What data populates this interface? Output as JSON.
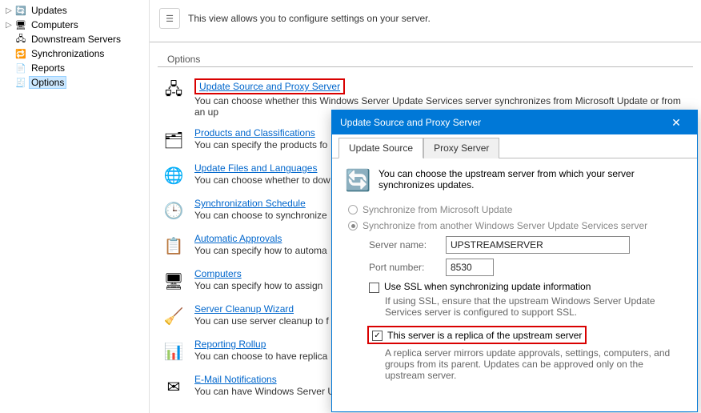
{
  "tree": {
    "items": [
      {
        "label": "Updates",
        "icon": "🔄",
        "expander": "▷"
      },
      {
        "label": "Computers",
        "icon": "🖥",
        "expander": "▷"
      },
      {
        "label": "Downstream Servers",
        "icon": "🖧",
        "expander": " "
      },
      {
        "label": "Synchronizations",
        "icon": "🔁",
        "expander": " "
      },
      {
        "label": "Reports",
        "icon": "📄",
        "expander": " "
      },
      {
        "label": "Options",
        "icon": "🧾",
        "expander": " ",
        "selected": true
      }
    ]
  },
  "page": {
    "desc": "This view allows you to configure settings on your server.",
    "options_header": "Options"
  },
  "options": [
    {
      "title": "Update Source and Proxy Server",
      "desc": "You can choose whether this Windows Server Update Services server synchronizes from Microsoft Update or from an up",
      "highlight": true,
      "icon": "🖧"
    },
    {
      "title": "Products and Classifications",
      "desc": "You can specify the products fo",
      "icon": "🗂"
    },
    {
      "title": "Update Files and Languages",
      "desc": "You can choose whether to dow",
      "icon": "🌐"
    },
    {
      "title": "Synchronization Schedule",
      "desc": "You can choose to synchronize",
      "icon": "🕒"
    },
    {
      "title": "Automatic Approvals",
      "desc": "You can specify how to automa",
      "icon": "📋"
    },
    {
      "title": "Computers",
      "desc": "You can specify how to assign",
      "icon": "🖥"
    },
    {
      "title": "Server Cleanup Wizard",
      "desc": "You can use server cleanup to f",
      "icon": "🧹"
    },
    {
      "title": "Reporting Rollup",
      "desc": "You can choose to have replica",
      "icon": "📊"
    },
    {
      "title": "E-Mail Notifications",
      "desc": "You can have Windows Server U",
      "icon": "✉"
    }
  ],
  "dialog": {
    "title": "Update Source and Proxy Server",
    "tabs": {
      "t1": "Update Source",
      "t2": "Proxy Server"
    },
    "intro": "You can choose the upstream server from which your server synchronizes updates.",
    "radio1": "Synchronize from Microsoft Update",
    "radio2": "Synchronize from another Windows Server Update Services server",
    "server_label": "Server name:",
    "server_value": "UPSTREAMSERVER",
    "port_label": "Port number:",
    "port_value": "8530",
    "ssl_label": "Use SSL when synchronizing update information",
    "ssl_note": "If using SSL, ensure that the upstream Windows Server Update Services server is configured to support SSL.",
    "replica_label": "This server is a replica of the upstream server",
    "replica_note": "A replica server mirrors update approvals, settings, computers, and groups from its parent. Updates can be approved only on the upstream server."
  }
}
